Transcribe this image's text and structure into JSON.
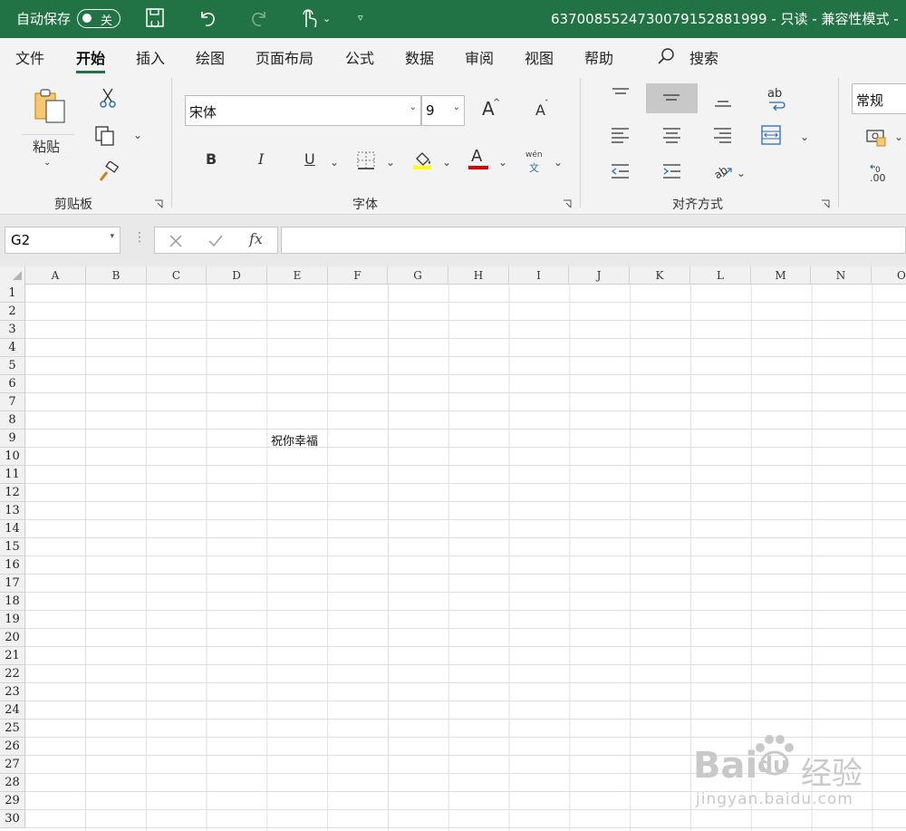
{
  "titlebar": {
    "autosave_label": "自动保存",
    "autosave_toggle": "关",
    "doc_title": "637008552473007915288199​9  -  只读  -  兼容性模式  -"
  },
  "tabs": [
    "文件",
    "开始",
    "插入",
    "绘图",
    "页面布局",
    "公式",
    "数据",
    "审阅",
    "视图",
    "帮助"
  ],
  "active_tab": "开始",
  "search_label": "搜索",
  "ribbon": {
    "clipboard": {
      "label": "剪贴板",
      "paste": "粘贴"
    },
    "font": {
      "label": "字体",
      "font_name": "宋体",
      "font_size": "9",
      "bold": "B",
      "italic": "I",
      "underline": "U",
      "grow": "A",
      "shrink": "A",
      "font_color": "A",
      "phonetic_top": "wén",
      "phonetic_bottom": "文"
    },
    "alignment": {
      "label": "对齐方式",
      "wrap": "ab"
    },
    "number": {
      "format": "常规"
    }
  },
  "formula_bar": {
    "name_box": "G2",
    "fx": "fx",
    "content": ""
  },
  "sheet": {
    "columns": [
      "A",
      "B",
      "C",
      "D",
      "E",
      "F",
      "G",
      "H",
      "I",
      "J",
      "K",
      "L",
      "M",
      "N",
      "O"
    ],
    "rows": [
      "1",
      "2",
      "3",
      "4",
      "5",
      "6",
      "7",
      "8",
      "9",
      "10",
      "11",
      "12",
      "13",
      "14",
      "15",
      "16",
      "17",
      "18",
      "19",
      "20",
      "21",
      "22",
      "23",
      "24",
      "25",
      "26",
      "27",
      "28",
      "29",
      "30"
    ],
    "cells": [
      {
        "ref": "E9",
        "value": "祝你幸福"
      }
    ]
  },
  "watermark": {
    "brand": "Bai",
    "brand2": "du",
    "product": "经验",
    "url": "jingyan.baidu.com"
  },
  "colors": {
    "accent": "#217346",
    "font_color_bar": "#e00000",
    "highlight_bar": "#ffff00"
  }
}
